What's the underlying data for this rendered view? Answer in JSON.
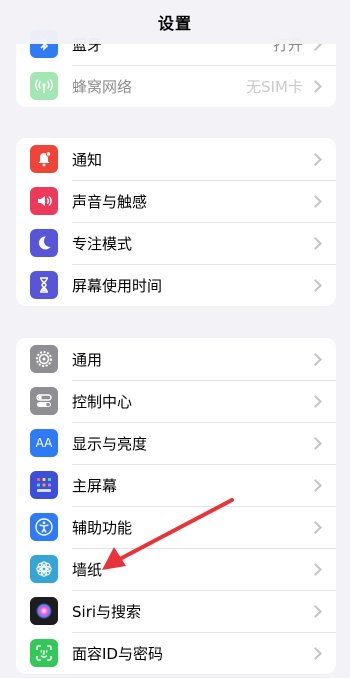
{
  "nav": {
    "title": "设置"
  },
  "group1": [
    {
      "label": "蓝牙",
      "value": "打开",
      "icon": "bluetooth-icon",
      "color": "#2f7bf6"
    },
    {
      "label": "蜂窝网络",
      "value": "无SIM卡",
      "icon": "antenna-icon",
      "color": "#34c759"
    }
  ],
  "group2": [
    {
      "label": "通知",
      "icon": "bell-icon",
      "color": "#ef4438"
    },
    {
      "label": "声音与触感",
      "icon": "speaker-icon",
      "color": "#ee3a5a"
    },
    {
      "label": "专注模式",
      "icon": "moon-icon",
      "color": "#5856d6"
    },
    {
      "label": "屏幕使用时间",
      "icon": "hourglass-icon",
      "color": "#5856d6"
    }
  ],
  "group3": [
    {
      "label": "通用",
      "icon": "gear-icon",
      "color": "#8e8e93"
    },
    {
      "label": "控制中心",
      "icon": "toggles-icon",
      "color": "#8e8e93"
    },
    {
      "label": "显示与亮度",
      "icon": "text-size-icon",
      "color": "#2f7bf6"
    },
    {
      "label": "主屏幕",
      "icon": "home-grid-icon",
      "color": "#3b4fd8"
    },
    {
      "label": "辅助功能",
      "icon": "accessibility-icon",
      "color": "#2f7bf6"
    },
    {
      "label": "墙纸",
      "icon": "flower-icon",
      "color": "#35a5d8"
    },
    {
      "label": "Siri与搜索",
      "icon": "siri-icon",
      "color": "#1c1c1e"
    },
    {
      "label": "面容ID与密码",
      "icon": "face-id-icon",
      "color": "#34c759"
    }
  ],
  "annotation": {
    "color": "#e8333a"
  }
}
